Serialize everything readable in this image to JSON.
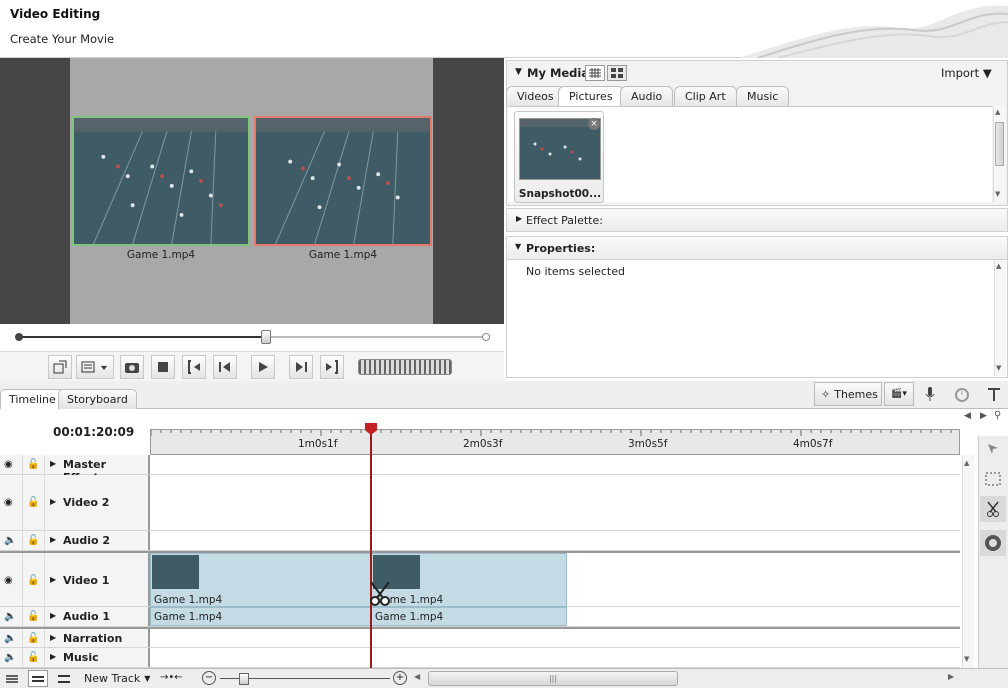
{
  "header": {
    "title": "Video Editing",
    "subtitle": "Create Your Movie"
  },
  "preview": {
    "clips": [
      {
        "label": "Game 1.mp4"
      },
      {
        "label": "Game 1.mp4"
      }
    ],
    "position": 0.5
  },
  "toolbar": {
    "icons": [
      "resize-icon",
      "display-mode-icon",
      "camera-icon",
      "stop-icon",
      "goto-start-icon",
      "prev-frame-icon",
      "play-icon",
      "next-frame-icon",
      "goto-end-icon",
      "shuttle-icon"
    ]
  },
  "media": {
    "title": "My Media",
    "import_label": "Import",
    "tabs": [
      "Videos",
      "Pictures",
      "Audio",
      "Clip Art",
      "Music"
    ],
    "active_tab": "Pictures",
    "items": [
      {
        "label": "Snapshot00..."
      }
    ]
  },
  "effect_palette": {
    "label": "Effect Palette:"
  },
  "properties": {
    "label": "Properties:",
    "message": "No items selected"
  },
  "bottom_tabs": [
    "Timeline",
    "Storyboard"
  ],
  "timeline_toolbar": {
    "themes_label": "Themes"
  },
  "timeline": {
    "timecode": "00:01:20:09",
    "ticks": [
      "1m0s1f",
      "2m0s3f",
      "3m0s5f",
      "4m0s7f"
    ],
    "tracks": [
      {
        "name": "Master Effects",
        "icon": "eye-icon"
      },
      {
        "name": "Video 2",
        "icon": "eye-icon"
      },
      {
        "name": "Audio 2",
        "icon": "speaker-icon"
      },
      {
        "name": "Video 1",
        "icon": "eye-icon"
      },
      {
        "name": "Audio 1",
        "icon": "speaker-icon"
      },
      {
        "name": "Narration",
        "icon": "speaker-icon"
      },
      {
        "name": "Music",
        "icon": "speaker-icon"
      }
    ],
    "video1_clips": [
      {
        "label": "Game 1.mp4"
      },
      {
        "label": "Game 1.mp4"
      }
    ],
    "audio1_clips": [
      {
        "label": "Game 1.mp4"
      },
      {
        "label": "Game 1.mp4"
      }
    ]
  },
  "bottom_bar": {
    "new_track_label": "New Track"
  },
  "colors": {
    "accent": "#c42222",
    "clip": "#c4dbe6",
    "selected_border": "#e57a6c",
    "normal_border": "#7fc47a"
  }
}
